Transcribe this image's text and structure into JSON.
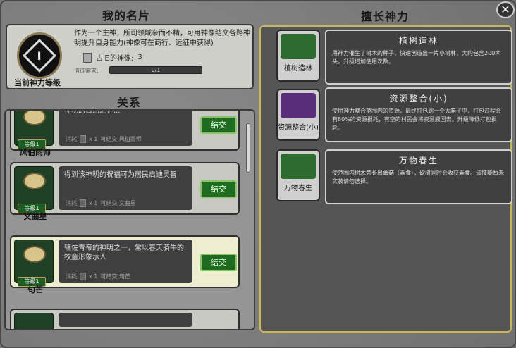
{
  "left_title": "我的名片",
  "card": {
    "emblem_symbol": "I",
    "level_label": "当前神力等级",
    "description": "作为一个主神，所司领域杂而不精，可用神像结交各路神明提升自身能力(神像可在商行、远征中获得)",
    "ancient_idol_label": "古旧的神像:",
    "ancient_idol_count": "3",
    "belief_label": "信徒需求:",
    "belief_progress": "0/1"
  },
  "relations_title": "关系",
  "relations": [
    {
      "name": "风伯雨师",
      "level": "等级1",
      "text": "神秘的自然之神...",
      "cost_label": "消耗",
      "cost_count": "x 1",
      "cost_text": "可结交 风伯雨师",
      "button": "结交",
      "highlight": false
    },
    {
      "name": "文曲星",
      "level": "等级1",
      "text": "得到该神明的祝福可为居民启迪灵智",
      "cost_label": "消耗",
      "cost_count": "x 1",
      "cost_text": "可结交 文曲星",
      "button": "结交",
      "highlight": false
    },
    {
      "name": "句芒",
      "level": "等级1",
      "text": "辅佐青帝的神明之一，常以春天骑牛的牧童形象示人",
      "cost_label": "消耗",
      "cost_count": "x 1",
      "cost_text": "可结交 句芒",
      "button": "结交",
      "highlight": true
    }
  ],
  "right_title": "擅长神力",
  "skills": [
    {
      "icon_label": "植树造林",
      "title": "植树造林",
      "desc": "用神力催生了树木的种子，快速创造出一片小树林，大约包含200木头。升级增加使用次数。",
      "color": "#2e6b2e"
    },
    {
      "icon_label": "资源整合(小)",
      "title": "资源整合(小)",
      "desc": "使用神力整合范围内的资源，最终打包到一个大箱子中，打包过程会有80%的资源损耗，有空的村民会将资源搬回去。升级降低打包损耗。",
      "color": "#5b2c7a"
    },
    {
      "icon_label": "万物春生",
      "title": "万物春生",
      "desc": "使范围内树木旁长出蘑菇（素食），砍树同时会收获素食。该技能暂未实装请勿选择。",
      "color": "#2e6b2e"
    }
  ],
  "close_symbol": "✕"
}
